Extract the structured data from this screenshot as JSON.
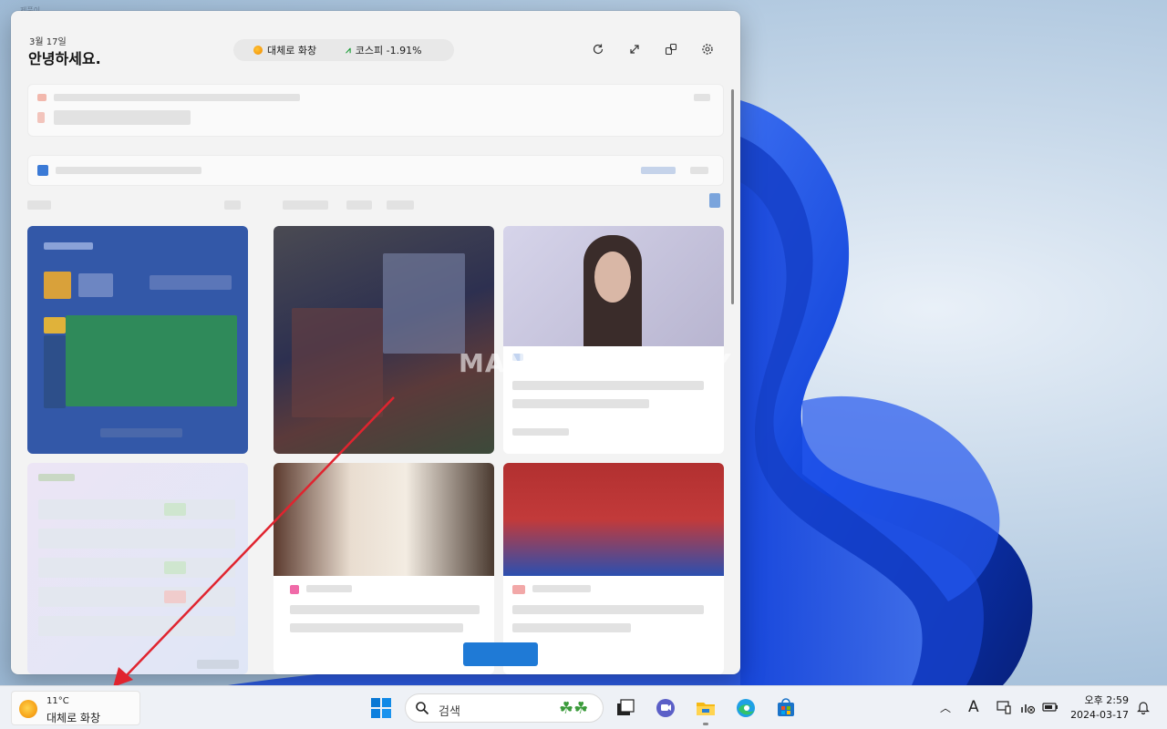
{
  "desktop": {
    "corner_label": "제품이"
  },
  "widgets": {
    "date": "3월 17일",
    "greeting": "안녕하세요.",
    "weather_chip": "대체로 화창",
    "stock_chip": "코스피 -1.91%",
    "header_icons": [
      "refresh-icon",
      "expand-icon",
      "people-icon",
      "settings-icon"
    ],
    "watermark": "MANUAL FACTORY"
  },
  "taskbar": {
    "weather_temp": "11°C",
    "weather_condition": "대체로 화창",
    "search_placeholder": "검색",
    "apps": [
      "start-icon",
      "task-view-icon",
      "chat-icon",
      "file-explorer-icon",
      "edge-icon",
      "store-icon"
    ],
    "clock_time": "오후 2:59",
    "clock_date": "2024-03-17",
    "accent": "#0067c0"
  }
}
